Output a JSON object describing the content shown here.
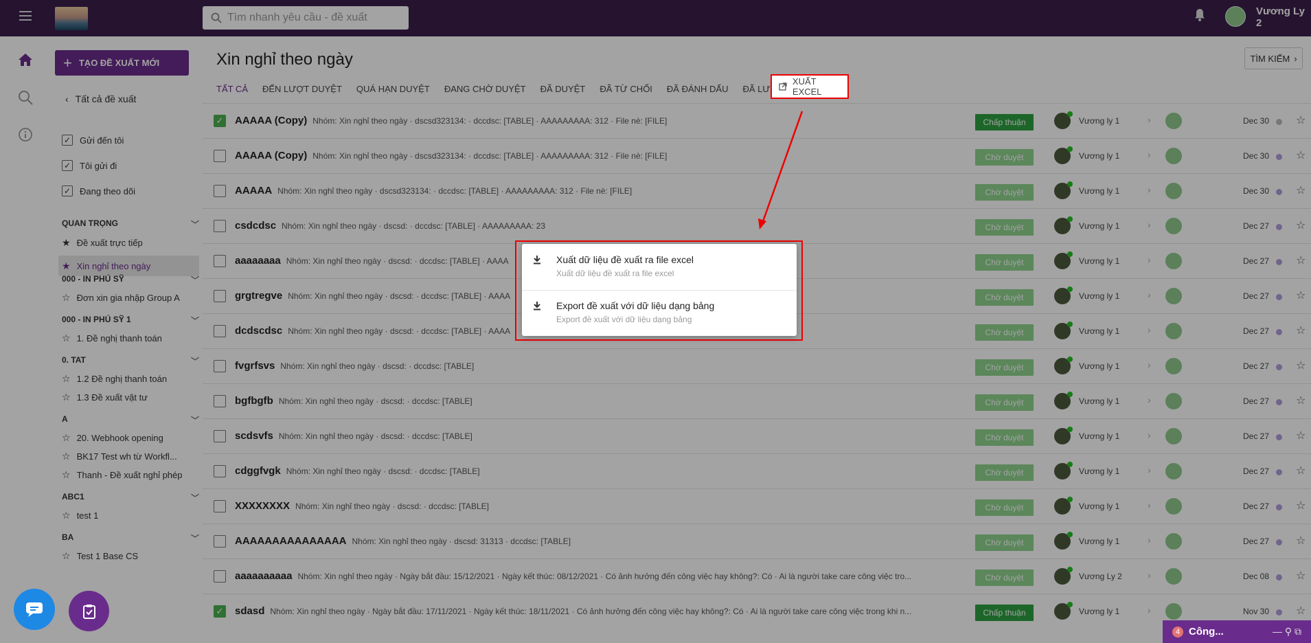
{
  "header": {
    "search_placeholder": "Tìm nhanh yêu cầu - đề xuất",
    "user_name": "Vương Ly 2"
  },
  "sidebar": {
    "new_button": "TẠO ĐỀ XUẤT MỚI",
    "back": "Tất cả đề xuất",
    "filters": [
      "Gửi đến tôi",
      "Tôi gửi đi",
      "Đang theo dõi"
    ],
    "sections": [
      {
        "title": "QUAN TRỌNG",
        "items": [
          "Đề xuất trực tiếp",
          "Xin nghỉ theo ngày"
        ]
      },
      {
        "title": "000 - IN PHÚ SỸ",
        "items": [
          "Đơn xin gia nhập Group A"
        ]
      },
      {
        "title": "000 - IN PHÚ SỸ 1",
        "items": [
          "1. Đề nghị thanh toán"
        ]
      },
      {
        "title": "0. TAT",
        "items": [
          "1.2 Đề nghị thanh toán",
          "1.3 Đề xuất vật tư"
        ]
      },
      {
        "title": "A",
        "items": [
          "20. Webhook opening",
          "BK17 Test wh từ Workfl...",
          "Thanh - Đề xuất nghỉ phép"
        ]
      },
      {
        "title": "ABC1",
        "items": [
          "test 1"
        ]
      },
      {
        "title": "BA",
        "items": [
          "Test 1 Base CS"
        ]
      }
    ]
  },
  "main": {
    "title": "Xin nghỉ theo ngày",
    "find_button": "TÌM KIẾM",
    "tabs": [
      "TẤT CẢ",
      "ĐẾN LƯỢT DUYỆT",
      "QUÁ HẠN DUYỆT",
      "ĐANG CHỜ DUYỆT",
      "ĐÃ DUYỆT",
      "ĐÃ TỪ CHỐI",
      "ĐÃ ĐÁNH DẤU",
      "ĐÃ LƯU NHÁP"
    ],
    "export_button": "XUẤT EXCEL"
  },
  "rows": [
    {
      "title": "AAAAA (Copy)",
      "desc": "Nhóm: Xin nghỉ theo ngày · dscsd323134: · dccdsc: [TABLE] · AAAAAAAAA: 312 · File nè: [FILE]",
      "status": "Chấp thuận",
      "user": "Vương ly 1",
      "date": "Dec 30",
      "checked": true
    },
    {
      "title": "AAAAA (Copy)",
      "desc": "Nhóm: Xin nghỉ theo ngày · dscsd323134: · dccdsc: [TABLE] · AAAAAAAAA: 312 · File nè: [FILE]",
      "status": "Chờ duyệt",
      "user": "Vương ly 1",
      "date": "Dec 30",
      "checked": false
    },
    {
      "title": "AAAAA",
      "desc": "Nhóm: Xin nghỉ theo ngày · dscsd323134: · dccdsc: [TABLE] · AAAAAAAAA: 312 · File nè: [FILE]",
      "status": "Chờ duyệt",
      "user": "Vương ly 1",
      "date": "Dec 30",
      "checked": false
    },
    {
      "title": "csdcdsc",
      "desc": "Nhóm: Xin nghỉ theo ngày · dscsd: · dccdsc: [TABLE] · AAAAAAAAA: 23",
      "status": "Chờ duyệt",
      "user": "Vương ly 1",
      "date": "Dec 27",
      "checked": false
    },
    {
      "title": "aaaaaaaa",
      "desc": "Nhóm: Xin nghỉ theo ngày · dscsd: · dccdsc: [TABLE] · AAAA",
      "status": "Chờ duyệt",
      "user": "Vương ly 1",
      "date": "Dec 27",
      "checked": false
    },
    {
      "title": "grgtregve",
      "desc": "Nhóm: Xin nghỉ theo ngày · dscsd: · dccdsc: [TABLE] · AAAA",
      "status": "Chờ duyệt",
      "user": "Vương ly 1",
      "date": "Dec 27",
      "checked": false
    },
    {
      "title": "dcdscdsc",
      "desc": "Nhóm: Xin nghỉ theo ngày · dscsd: · dccdsc: [TABLE] · AAAA",
      "status": "Chờ duyệt",
      "user": "Vương ly 1",
      "date": "Dec 27",
      "checked": false
    },
    {
      "title": "fvgrfsvs",
      "desc": "Nhóm: Xin nghỉ theo ngày · dscsd: · dccdsc: [TABLE]",
      "status": "Chờ duyệt",
      "user": "Vương ly 1",
      "date": "Dec 27",
      "checked": false
    },
    {
      "title": "bgfbgfb",
      "desc": "Nhóm: Xin nghỉ theo ngày · dscsd: · dccdsc: [TABLE]",
      "status": "Chờ duyệt",
      "user": "Vương ly 1",
      "date": "Dec 27",
      "checked": false
    },
    {
      "title": "scdsvfs",
      "desc": "Nhóm: Xin nghỉ theo ngày · dscsd: · dccdsc: [TABLE]",
      "status": "Chờ duyệt",
      "user": "Vương ly 1",
      "date": "Dec 27",
      "checked": false
    },
    {
      "title": "cdggfvgk",
      "desc": "Nhóm: Xin nghỉ theo ngày · dscsd: · dccdsc: [TABLE]",
      "status": "Chờ duyệt",
      "user": "Vương ly 1",
      "date": "Dec 27",
      "checked": false
    },
    {
      "title": "XXXXXXXX",
      "desc": "Nhóm: Xin nghỉ theo ngày · dscsd: · dccdsc: [TABLE]",
      "status": "Chờ duyệt",
      "user": "Vương ly 1",
      "date": "Dec 27",
      "checked": false
    },
    {
      "title": "AAAAAAAAAAAAAAA",
      "desc": "Nhóm: Xin nghỉ theo ngày · dscsd: 31313 · dccdsc: [TABLE]",
      "status": "Chờ duyệt",
      "user": "Vương ly 1",
      "date": "Dec 27",
      "checked": false
    },
    {
      "title": "aaaaaaaaaa",
      "desc": "Nhóm: Xin nghỉ theo ngày · Ngày bắt đầu: 15/12/2021 · Ngày kết thúc: 08/12/2021 · Có ảnh hưởng đến công việc hay không?: Có · Ai là người take care công việc tro...",
      "status": "Chờ duyệt",
      "user": "Vương Ly 2",
      "date": "Dec 08",
      "checked": false
    },
    {
      "title": "sdasd",
      "desc": "Nhóm: Xin nghỉ theo ngày · Ngày bắt đầu: 17/11/2021 · Ngày kết thúc: 18/11/2021 · Có ảnh hưởng đến công việc hay không?: Có · Ai là người take care công việc trong khi n...",
      "status": "Chấp thuận",
      "user": "Vương ly 1",
      "date": "Nov 30",
      "checked": true
    }
  ],
  "popup": {
    "items": [
      {
        "title": "Xuất dữ liệu đề xuất ra file excel",
        "subtitle": "Xuất dữ liệu đề xuất ra file excel"
      },
      {
        "title": "Export đề xuất với dữ liệu dạng bảng",
        "subtitle": "Export đề xuất với dữ liệu dạng bảng"
      }
    ]
  },
  "mini_chat": {
    "badge": "4",
    "label": "Công..."
  }
}
